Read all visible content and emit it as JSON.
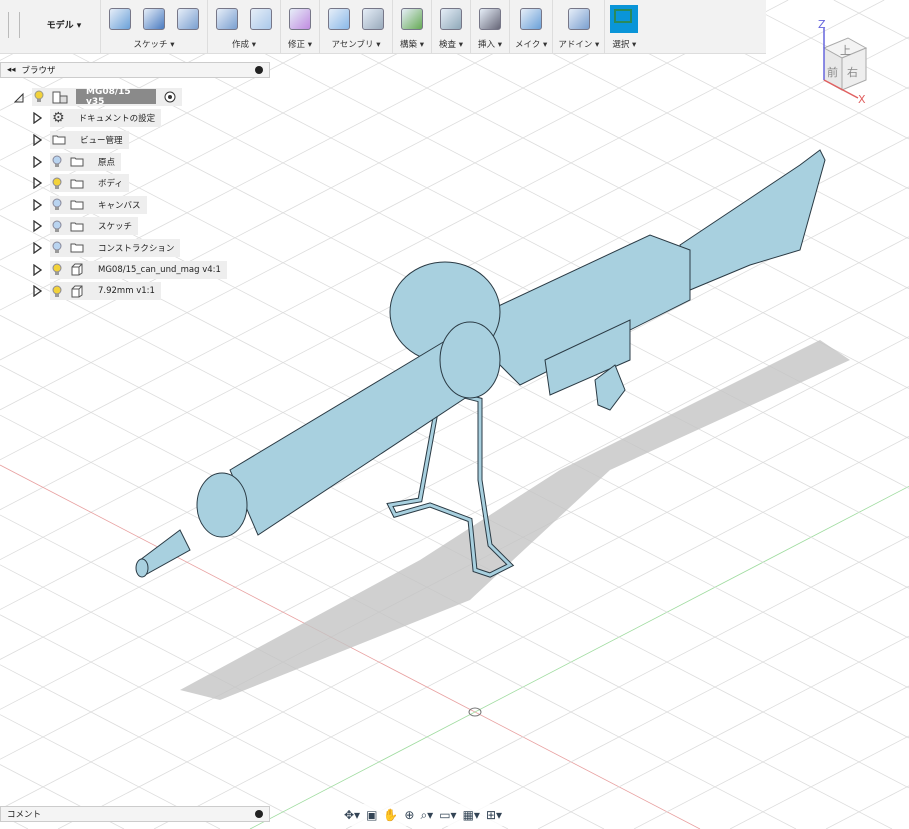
{
  "toolbar": {
    "workspace": "モデル ▾",
    "groups": [
      {
        "label": "スケッチ ▾",
        "icons": [
          "create-sketch-icon",
          "spline-icon",
          "rectangle-icon"
        ]
      },
      {
        "label": "作成 ▾",
        "icons": [
          "extrude-icon",
          "form-icon"
        ]
      },
      {
        "label": "修正 ▾",
        "icons": [
          "press-pull-icon"
        ]
      },
      {
        "label": "アセンブリ ▾",
        "icons": [
          "new-component-icon",
          "joint-icon"
        ]
      },
      {
        "label": "構築 ▾",
        "icons": [
          "offset-plane-icon"
        ]
      },
      {
        "label": "検査 ▾",
        "icons": [
          "measure-icon"
        ]
      },
      {
        "label": "挿入 ▾",
        "icons": [
          "insert-image-icon"
        ]
      },
      {
        "label": "メイク ▾",
        "icons": [
          "3d-print-icon"
        ]
      },
      {
        "label": "アドイン ▾",
        "icons": [
          "scripts-addins-icon"
        ]
      },
      {
        "label": "選択 ▾",
        "icons": [
          "select-icon"
        ]
      }
    ]
  },
  "browser": {
    "title": "ブラウザ",
    "root": "MG08/15 v35",
    "items": [
      {
        "label": "ドキュメントの設定",
        "icon": "gear-icon",
        "bulb": "none"
      },
      {
        "label": "ビュー管理",
        "icon": "folder-icon",
        "bulb": "none"
      },
      {
        "label": "原点",
        "icon": "folder-icon",
        "bulb": "off"
      },
      {
        "label": "ボディ",
        "icon": "folder-icon",
        "bulb": "on"
      },
      {
        "label": "キャンバス",
        "icon": "folder-icon",
        "bulb": "off"
      },
      {
        "label": "スケッチ",
        "icon": "folder-icon",
        "bulb": "off"
      },
      {
        "label": "コンストラクション",
        "icon": "folder-icon",
        "bulb": "off"
      },
      {
        "label": "MG08/15_can_und_mag v4:1",
        "icon": "component-icon",
        "bulb": "on"
      },
      {
        "label": "7.92mm v1:1",
        "icon": "component-icon",
        "bulb": "on"
      }
    ]
  },
  "comments": {
    "title": "コメント"
  },
  "viewcube": {
    "top": "上",
    "front": "前",
    "right": "右",
    "z": "Z",
    "x": "X"
  },
  "colors": {
    "model": "#a8d0df",
    "select": "#0a95d8",
    "bulb_on": "#f2d23a",
    "bulb_off": "#b9d4f0"
  }
}
